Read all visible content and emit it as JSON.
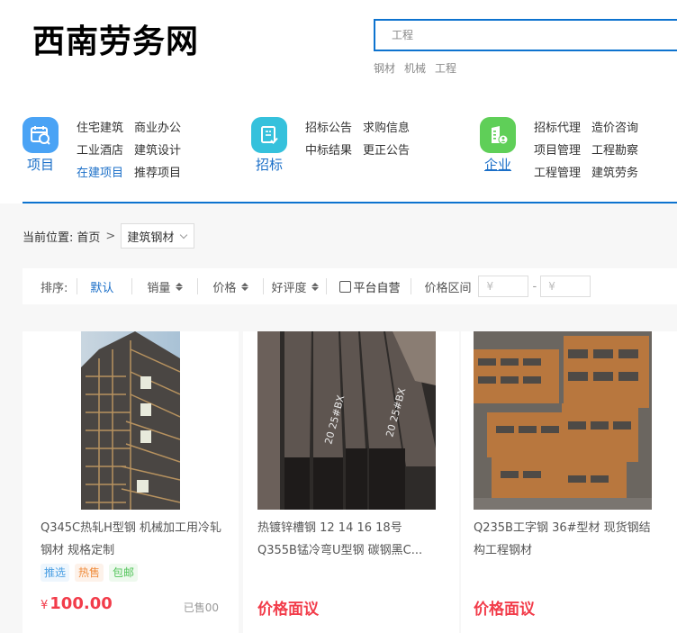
{
  "header": {
    "logo": "西南劳务网",
    "search": {
      "value": "",
      "placeholder": "工程"
    },
    "hot_words": [
      "钢材",
      "机械",
      "工程"
    ]
  },
  "nav": [
    {
      "title": "项目",
      "icon": "calendar-search-icon",
      "color": "#4aa3f5",
      "links": [
        {
          "label": "住宅建筑",
          "active": false
        },
        {
          "label": "商业办公",
          "active": false
        },
        {
          "label": "工业酒店",
          "active": false
        },
        {
          "label": "建筑设计",
          "active": false
        },
        {
          "label": "在建项目",
          "active": true
        },
        {
          "label": "推荐项目",
          "active": false
        }
      ]
    },
    {
      "title": "招标",
      "icon": "document-check-icon",
      "color": "#35c1dc",
      "links": [
        {
          "label": "招标公告",
          "active": false
        },
        {
          "label": "求购信息",
          "active": false
        },
        {
          "label": "中标结果",
          "active": false
        },
        {
          "label": "更正公告",
          "active": false
        }
      ]
    },
    {
      "title": "企业",
      "icon": "building-user-icon",
      "color": "#5fcf58",
      "links": [
        {
          "label": "招标代理",
          "active": false
        },
        {
          "label": "造价咨询",
          "active": false
        },
        {
          "label": "项目管理",
          "active": false
        },
        {
          "label": "工程勘察",
          "active": false
        },
        {
          "label": "工程管理",
          "active": false
        },
        {
          "label": "建筑劳务",
          "active": false
        }
      ]
    }
  ],
  "breadcrumb": {
    "label": "当前位置:",
    "home": "首页",
    "separator": ">",
    "current": "建筑钢材"
  },
  "sort": {
    "label": "排序:",
    "items": [
      "默认",
      "销量",
      "价格",
      "好评度"
    ],
    "active_index": 0,
    "self_operated": {
      "label": "平台自营",
      "checked": false
    },
    "price_range": {
      "label": "价格区间",
      "min_placeholder": "¥",
      "max_placeholder": "¥",
      "separator": "-"
    }
  },
  "products": [
    {
      "title": "Q345C热轧H型钢 机械加工用冷轧钢材 规格定制",
      "tags": [
        "推选",
        "热售",
        "包邮"
      ],
      "price_symbol": "¥",
      "price": "100.00",
      "sold": "已售00",
      "image": "stacked-h-beams"
    },
    {
      "title": "热镀锌槽钢 12 14 16 18号 Q355B锰冷弯U型钢 碳钢黑C...",
      "tags": [],
      "price_text": "价格面议",
      "image": "channel-steel-bundle"
    },
    {
      "title": "Q235B工字钢 36#型材 现货钢结构工程钢材",
      "tags": [],
      "price_text": "价格面议",
      "image": "rusty-i-beams"
    }
  ],
  "colors": {
    "accent": "#0d73cf",
    "price": "#f23c4a",
    "link_active": "#1b6fc8"
  }
}
